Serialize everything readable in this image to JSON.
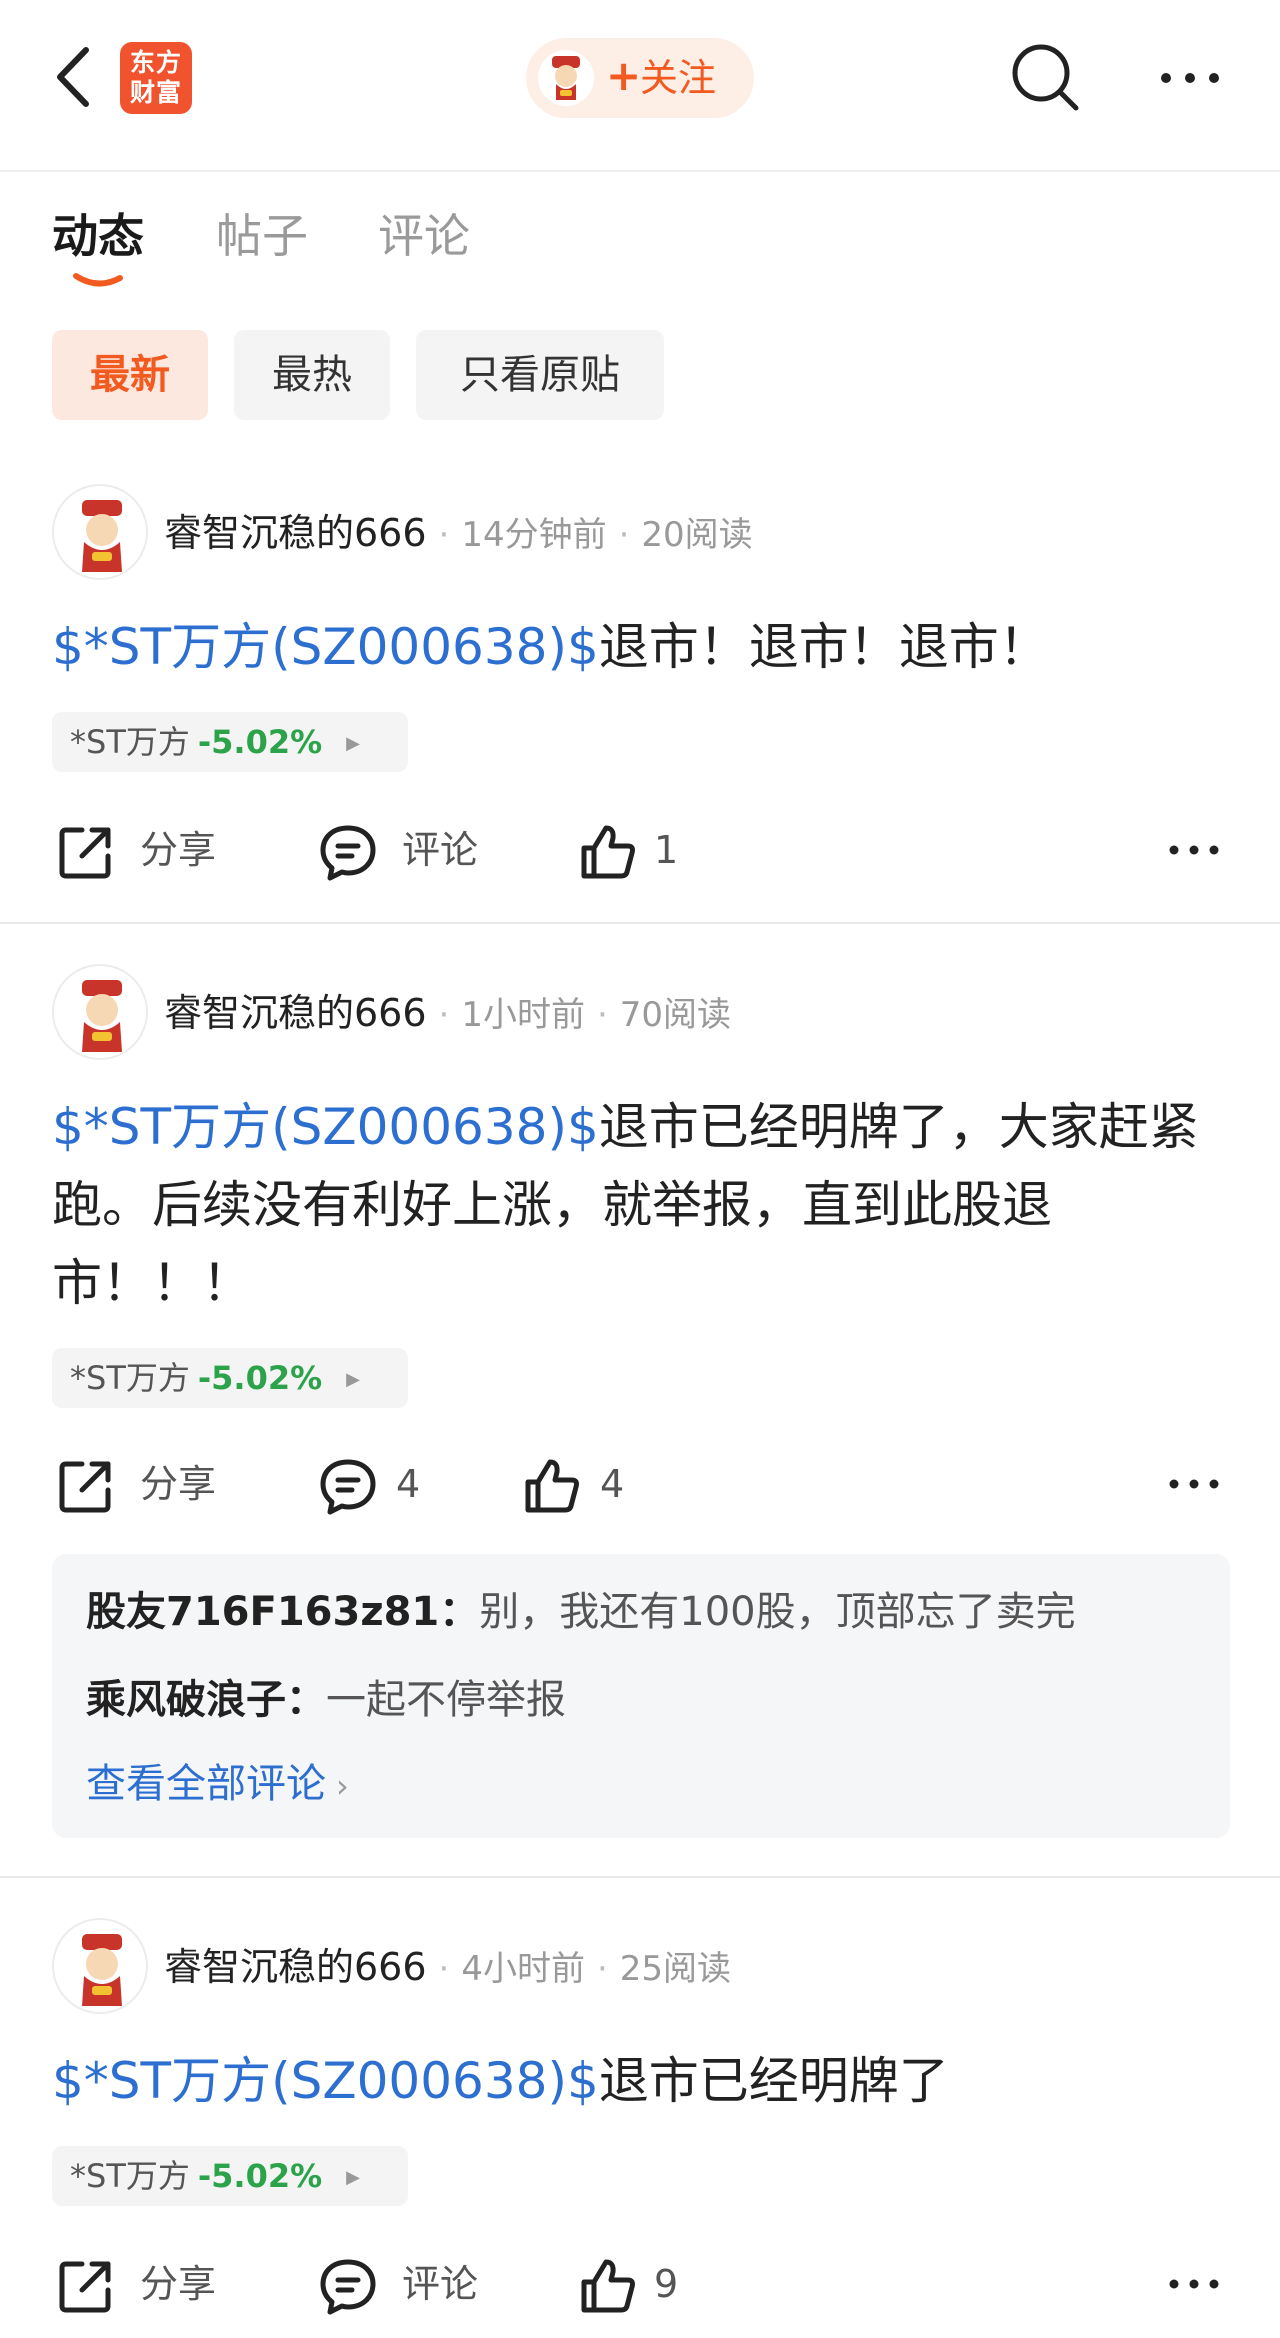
{
  "header": {
    "logo_line1": "东方",
    "logo_line2": "财富",
    "follow_plus": "+",
    "follow_label": "关注"
  },
  "tabs": [
    {
      "label": "动态",
      "active": true
    },
    {
      "label": "帖子",
      "active": false
    },
    {
      "label": "评论",
      "active": false
    }
  ],
  "filters": [
    {
      "label": "最新",
      "active": true
    },
    {
      "label": "最热",
      "active": false
    },
    {
      "label": "只看原贴",
      "active": false
    }
  ],
  "colors": {
    "accent": "#f25a1f",
    "link": "#2d6fd0",
    "change_down": "#2ca34a"
  },
  "posts": [
    {
      "author": "睿智沉稳的666",
      "time": "14分钟前",
      "reads": "20阅读",
      "tag": "$*ST万方(SZ000638)$",
      "text": "退市！退市！退市！",
      "stock_name": "*ST万方",
      "stock_change": "-5.02%",
      "share_label": "分享",
      "comment_label": "评论",
      "like_count": "1"
    },
    {
      "author": "睿智沉稳的666",
      "time": "1小时前",
      "reads": "70阅读",
      "tag": "$*ST万方(SZ000638)$",
      "text": "退市已经明牌了，大家赶紧跑。后续没有利好上涨，就举报，直到此股退市！！！",
      "stock_name": "*ST万方",
      "stock_change": "-5.02%",
      "share_label": "分享",
      "comment_label": "4",
      "like_count": "4",
      "comments": [
        {
          "author": "股友716F163z81：",
          "text": "别，我还有100股，顶部忘了卖完"
        },
        {
          "author": "乘风破浪子：",
          "text": "一起不停举报"
        }
      ],
      "view_all": "查看全部评论"
    },
    {
      "author": "睿智沉稳的666",
      "time": "4小时前",
      "reads": "25阅读",
      "tag": "$*ST万方(SZ000638)$",
      "text": "退市已经明牌了",
      "stock_name": "*ST万方",
      "stock_change": "-5.02%",
      "share_label": "分享",
      "comment_label": "评论",
      "like_count": "9"
    }
  ]
}
